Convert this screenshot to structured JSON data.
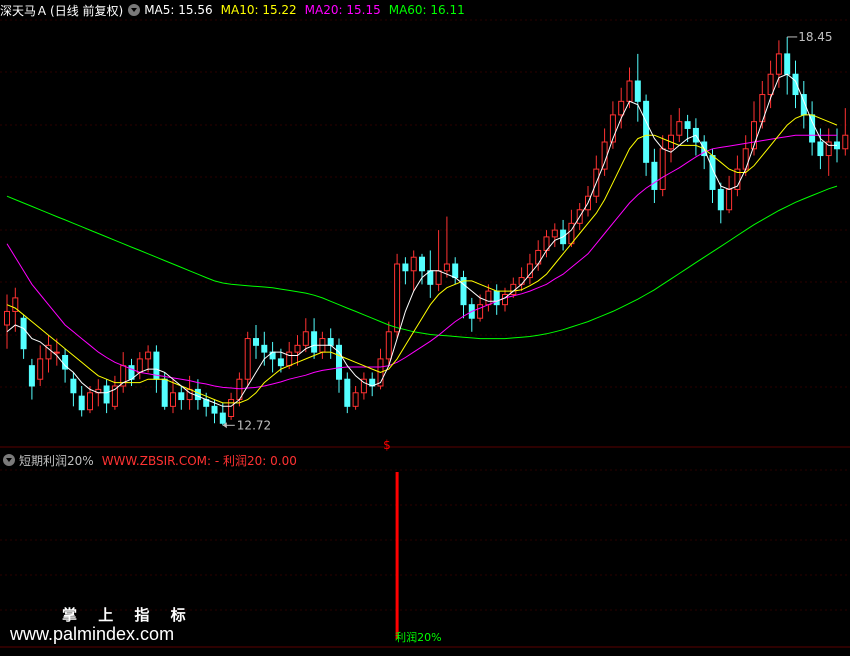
{
  "header": {
    "symbol": "深天马Ａ",
    "period": "(日线 前复权)",
    "ma": [
      {
        "label": "MA5: 15.56",
        "color": "#ffffff"
      },
      {
        "label": "MA10: 15.22",
        "color": "#ffff00"
      },
      {
        "label": "MA20: 15.15",
        "color": "#ff00ff"
      },
      {
        "label": "MA60: 16.11",
        "color": "#00ff00"
      }
    ]
  },
  "indicator": {
    "name": "短期利润20%",
    "formula": "WWW.ZBSIR.COM: - 利润20: 0.00",
    "signal_label": "利润20%",
    "signal_marker": "$"
  },
  "watermark": {
    "title": "掌 上 指 标",
    "url": "www.palmindex.com"
  },
  "chart_data": {
    "type": "candlestick",
    "price_range": [
      12.4,
      18.7
    ],
    "high_label": "18.45",
    "low_label": "12.72",
    "colors": {
      "up": "#ff3232",
      "down": "#54ffff",
      "ma5": "#ffffff",
      "ma10": "#ffff00",
      "ma20": "#ff00ff",
      "ma60": "#00ff00",
      "signal": "#ff0000",
      "grid": "#5a0000"
    },
    "candles": [
      [
        14.2,
        14.4,
        13.85,
        14.65
      ],
      [
        14.4,
        14.6,
        14.1,
        14.75
      ],
      [
        14.3,
        13.85,
        13.7,
        14.35
      ],
      [
        13.6,
        13.3,
        13.1,
        13.7
      ],
      [
        13.4,
        13.7,
        13.3,
        13.9
      ],
      [
        13.7,
        13.9,
        13.5,
        14.05
      ],
      [
        13.8,
        13.8,
        13.6,
        14.0
      ],
      [
        13.75,
        13.55,
        13.35,
        13.85
      ],
      [
        13.4,
        13.2,
        13.0,
        13.5
      ],
      [
        13.15,
        12.95,
        12.85,
        13.3
      ],
      [
        12.95,
        13.2,
        12.9,
        13.3
      ],
      [
        13.2,
        13.25,
        13.0,
        13.4
      ],
      [
        13.3,
        13.05,
        12.9,
        13.4
      ],
      [
        13.0,
        13.3,
        12.95,
        13.45
      ],
      [
        13.3,
        13.6,
        13.2,
        13.8
      ],
      [
        13.6,
        13.4,
        13.3,
        13.7
      ],
      [
        13.5,
        13.7,
        13.4,
        13.8
      ],
      [
        13.7,
        13.8,
        13.5,
        13.9
      ],
      [
        13.8,
        13.4,
        13.2,
        13.9
      ],
      [
        13.4,
        13.0,
        12.95,
        13.5
      ],
      [
        13.0,
        13.2,
        12.9,
        13.4
      ],
      [
        13.2,
        13.1,
        12.95,
        13.3
      ],
      [
        13.1,
        13.25,
        12.95,
        13.45
      ],
      [
        13.25,
        13.1,
        12.95,
        13.4
      ],
      [
        13.1,
        13.0,
        12.85,
        13.2
      ],
      [
        13.0,
        12.9,
        12.75,
        13.1
      ],
      [
        12.9,
        12.75,
        12.72,
        13.05
      ],
      [
        12.85,
        13.1,
        12.8,
        13.2
      ],
      [
        13.1,
        13.4,
        13.0,
        13.5
      ],
      [
        13.4,
        14.0,
        13.3,
        14.1
      ],
      [
        14.0,
        13.9,
        13.7,
        14.2
      ],
      [
        13.9,
        13.8,
        13.6,
        14.1
      ],
      [
        13.8,
        13.7,
        13.5,
        13.95
      ],
      [
        13.7,
        13.6,
        13.5,
        13.85
      ],
      [
        13.6,
        13.8,
        13.55,
        13.95
      ],
      [
        13.8,
        13.9,
        13.6,
        14.05
      ],
      [
        13.9,
        14.1,
        13.8,
        14.3
      ],
      [
        14.1,
        13.8,
        13.7,
        14.3
      ],
      [
        13.8,
        14.0,
        13.7,
        14.1
      ],
      [
        14.0,
        13.9,
        13.7,
        14.15
      ],
      [
        13.9,
        13.4,
        13.2,
        14.0
      ],
      [
        13.4,
        13.0,
        12.9,
        13.5
      ],
      [
        13.0,
        13.2,
        12.95,
        13.3
      ],
      [
        13.2,
        13.4,
        13.1,
        13.5
      ],
      [
        13.4,
        13.3,
        13.15,
        13.5
      ],
      [
        13.3,
        13.7,
        13.25,
        13.85
      ],
      [
        13.7,
        14.1,
        13.6,
        14.25
      ],
      [
        14.1,
        15.1,
        14.0,
        15.25
      ],
      [
        15.1,
        15.0,
        14.8,
        15.2
      ],
      [
        15.0,
        15.2,
        14.7,
        15.3
      ],
      [
        15.2,
        15.0,
        14.8,
        15.25
      ],
      [
        15.0,
        14.8,
        14.6,
        15.3
      ],
      [
        14.8,
        15.0,
        14.7,
        15.6
      ],
      [
        15.0,
        15.1,
        14.9,
        15.8
      ],
      [
        15.1,
        14.9,
        14.8,
        15.2
      ],
      [
        14.9,
        14.5,
        14.3,
        15.0
      ],
      [
        14.5,
        14.3,
        14.1,
        14.6
      ],
      [
        14.3,
        14.5,
        14.25,
        14.65
      ],
      [
        14.5,
        14.7,
        14.4,
        14.8
      ],
      [
        14.7,
        14.5,
        14.35,
        14.8
      ],
      [
        14.5,
        14.65,
        14.4,
        14.75
      ],
      [
        14.65,
        14.8,
        14.6,
        14.9
      ],
      [
        14.8,
        14.9,
        14.7,
        15.05
      ],
      [
        14.9,
        15.1,
        14.8,
        15.25
      ],
      [
        15.1,
        15.3,
        15.0,
        15.45
      ],
      [
        15.3,
        15.5,
        15.2,
        15.6
      ],
      [
        15.5,
        15.6,
        15.35,
        15.7
      ],
      [
        15.6,
        15.4,
        15.3,
        15.75
      ],
      [
        15.4,
        15.7,
        15.35,
        15.9
      ],
      [
        15.7,
        15.9,
        15.6,
        16.0
      ],
      [
        15.9,
        16.1,
        15.8,
        16.25
      ],
      [
        16.1,
        16.5,
        16.0,
        16.7
      ],
      [
        16.5,
        16.9,
        16.4,
        17.1
      ],
      [
        16.9,
        17.3,
        16.8,
        17.5
      ],
      [
        17.3,
        17.5,
        17.1,
        17.7
      ],
      [
        17.5,
        17.8,
        17.4,
        18.0
      ],
      [
        17.8,
        17.5,
        17.2,
        18.2
      ],
      [
        17.5,
        16.6,
        16.4,
        17.6
      ],
      [
        16.6,
        16.2,
        16.0,
        16.8
      ],
      [
        16.2,
        16.8,
        16.1,
        17.0
      ],
      [
        16.8,
        17.0,
        16.6,
        17.3
      ],
      [
        17.0,
        17.2,
        16.9,
        17.4
      ],
      [
        17.2,
        17.1,
        16.9,
        17.3
      ],
      [
        17.1,
        16.9,
        16.7,
        17.25
      ],
      [
        16.9,
        16.7,
        16.5,
        17.0
      ],
      [
        16.7,
        16.2,
        16.0,
        16.8
      ],
      [
        16.2,
        15.9,
        15.7,
        16.3
      ],
      [
        15.9,
        16.2,
        15.85,
        16.4
      ],
      [
        16.2,
        16.5,
        16.1,
        16.7
      ],
      [
        16.5,
        16.8,
        16.4,
        17.0
      ],
      [
        16.8,
        17.2,
        16.7,
        17.5
      ],
      [
        17.2,
        17.6,
        17.1,
        17.8
      ],
      [
        17.6,
        17.9,
        17.4,
        18.1
      ],
      [
        17.9,
        18.2,
        17.7,
        18.4
      ],
      [
        18.2,
        17.9,
        17.6,
        18.45
      ],
      [
        17.9,
        17.6,
        17.4,
        18.1
      ],
      [
        17.6,
        17.3,
        17.1,
        17.8
      ],
      [
        17.3,
        16.9,
        16.7,
        17.5
      ],
      [
        16.9,
        16.7,
        16.5,
        17.1
      ],
      [
        16.7,
        16.9,
        16.4,
        17.1
      ],
      [
        16.9,
        16.8,
        16.6,
        17.1
      ],
      [
        16.8,
        17.0,
        16.7,
        17.4
      ]
    ],
    "ma5": [
      14.1,
      14.2,
      14.15,
      14.0,
      13.95,
      13.85,
      13.75,
      13.6,
      13.5,
      13.35,
      13.25,
      13.2,
      13.2,
      13.25,
      13.35,
      13.4,
      13.5,
      13.55,
      13.55,
      13.5,
      13.4,
      13.3,
      13.2,
      13.15,
      13.1,
      13.05,
      13.0,
      13.0,
      13.1,
      13.3,
      13.5,
      13.7,
      13.8,
      13.8,
      13.75,
      13.75,
      13.85,
      13.9,
      13.9,
      13.9,
      13.8,
      13.6,
      13.45,
      13.35,
      13.3,
      13.35,
      13.6,
      14.0,
      14.4,
      14.7,
      14.9,
      15.0,
      15.0,
      14.95,
      14.9,
      14.8,
      14.7,
      14.6,
      14.55,
      14.55,
      14.6,
      14.7,
      14.8,
      14.95,
      15.1,
      15.3,
      15.45,
      15.5,
      15.6,
      15.8,
      16.0,
      16.3,
      16.6,
      16.95,
      17.25,
      17.5,
      17.45,
      17.2,
      16.95,
      16.8,
      16.75,
      16.85,
      16.95,
      17.0,
      16.8,
      16.5,
      16.25,
      16.2,
      16.25,
      16.5,
      16.85,
      17.2,
      17.55,
      17.85,
      17.9,
      17.8,
      17.5,
      17.2,
      16.95,
      16.85,
      16.85
    ],
    "ma10": [
      14.5,
      14.45,
      14.35,
      14.25,
      14.15,
      14.05,
      13.95,
      13.85,
      13.75,
      13.65,
      13.55,
      13.45,
      13.4,
      13.35,
      13.35,
      13.35,
      13.35,
      13.4,
      13.4,
      13.4,
      13.35,
      13.3,
      13.25,
      13.2,
      13.15,
      13.1,
      13.05,
      13.05,
      13.05,
      13.1,
      13.2,
      13.35,
      13.45,
      13.55,
      13.6,
      13.65,
      13.7,
      13.75,
      13.8,
      13.8,
      13.75,
      13.7,
      13.65,
      13.6,
      13.55,
      13.5,
      13.55,
      13.7,
      13.9,
      14.1,
      14.3,
      14.5,
      14.65,
      14.75,
      14.8,
      14.85,
      14.85,
      14.8,
      14.75,
      14.7,
      14.7,
      14.7,
      14.72,
      14.78,
      14.85,
      14.95,
      15.1,
      15.25,
      15.4,
      15.55,
      15.7,
      15.85,
      16.05,
      16.3,
      16.55,
      16.8,
      16.95,
      17.0,
      17.0,
      16.95,
      16.9,
      16.85,
      16.85,
      16.85,
      16.8,
      16.7,
      16.6,
      16.5,
      16.45,
      16.45,
      16.55,
      16.7,
      16.85,
      17.0,
      17.15,
      17.25,
      17.3,
      17.3,
      17.25,
      17.2,
      17.15
    ],
    "ma20": [
      15.4,
      15.2,
      15.0,
      14.8,
      14.65,
      14.5,
      14.35,
      14.2,
      14.1,
      14.0,
      13.9,
      13.8,
      13.72,
      13.65,
      13.6,
      13.55,
      13.5,
      13.48,
      13.46,
      13.44,
      13.42,
      13.4,
      13.38,
      13.35,
      13.33,
      13.3,
      13.28,
      13.27,
      13.26,
      13.27,
      13.28,
      13.3,
      13.33,
      13.36,
      13.4,
      13.43,
      13.46,
      13.5,
      13.53,
      13.55,
      13.57,
      13.58,
      13.58,
      13.58,
      13.58,
      13.58,
      13.6,
      13.65,
      13.72,
      13.8,
      13.88,
      13.96,
      14.05,
      14.15,
      14.25,
      14.33,
      14.4,
      14.45,
      14.5,
      14.55,
      14.6,
      14.63,
      14.66,
      14.7,
      14.75,
      14.8,
      14.88,
      14.95,
      15.05,
      15.15,
      15.25,
      15.4,
      15.55,
      15.7,
      15.85,
      16.0,
      16.12,
      16.22,
      16.3,
      16.38,
      16.45,
      16.52,
      16.6,
      16.68,
      16.75,
      16.8,
      16.82,
      16.84,
      16.86,
      16.88,
      16.9,
      16.92,
      16.94,
      16.96,
      16.98,
      17.0,
      17.0,
      17.0,
      17.0,
      17.0,
      17.0
    ],
    "ma60": [
      16.1,
      16.05,
      16.0,
      15.95,
      15.9,
      15.85,
      15.8,
      15.75,
      15.7,
      15.65,
      15.6,
      15.55,
      15.5,
      15.45,
      15.4,
      15.35,
      15.3,
      15.25,
      15.2,
      15.15,
      15.1,
      15.05,
      15.0,
      14.95,
      14.9,
      14.85,
      14.82,
      14.8,
      14.79,
      14.78,
      14.77,
      14.76,
      14.75,
      14.73,
      14.71,
      14.69,
      14.67,
      14.64,
      14.6,
      14.55,
      14.5,
      14.45,
      14.4,
      14.35,
      14.3,
      14.25,
      14.2,
      14.16,
      14.13,
      14.1,
      14.08,
      14.06,
      14.05,
      14.04,
      14.03,
      14.02,
      14.01,
      14.0,
      14.0,
      14.0,
      14.0,
      14.01,
      14.02,
      14.03,
      14.05,
      14.07,
      14.1,
      14.13,
      14.17,
      14.21,
      14.25,
      14.3,
      14.35,
      14.4,
      14.46,
      14.52,
      14.58,
      14.65,
      14.72,
      14.8,
      14.88,
      14.96,
      15.04,
      15.12,
      15.2,
      15.28,
      15.36,
      15.44,
      15.52,
      15.6,
      15.68,
      15.75,
      15.82,
      15.89,
      15.95,
      16.01,
      16.06,
      16.11,
      16.16,
      16.21,
      16.25
    ],
    "signal_index": 47,
    "signal_value": 20
  }
}
